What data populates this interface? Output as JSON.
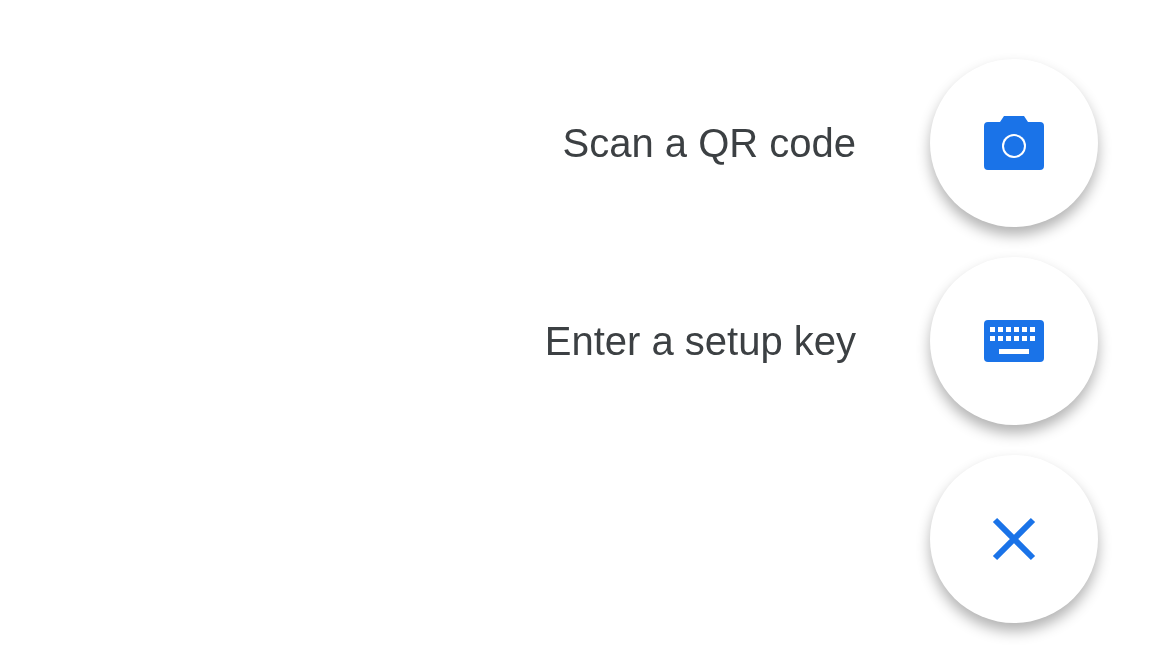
{
  "actions": [
    {
      "label": "Scan a QR code",
      "kind": "camera"
    },
    {
      "label": "Enter a setup key",
      "kind": "keyboard"
    }
  ],
  "close_button": {
    "kind": "close"
  }
}
